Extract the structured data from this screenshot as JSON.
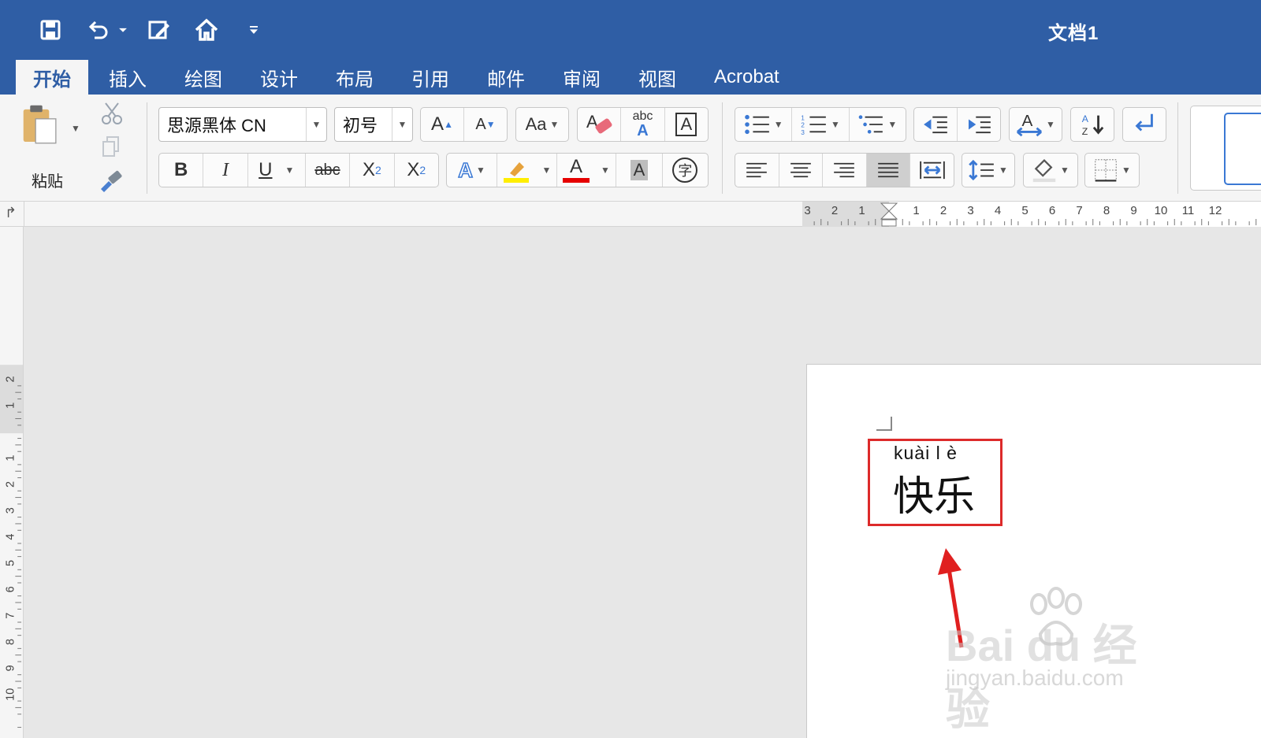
{
  "window": {
    "title": "文档1"
  },
  "quick_access": [
    {
      "name": "save-icon"
    },
    {
      "name": "undo-icon"
    },
    {
      "name": "edit-document-icon"
    },
    {
      "name": "home-icon"
    },
    {
      "name": "customize-toolbar-icon"
    }
  ],
  "tabs": [
    {
      "label": "开始",
      "active": true
    },
    {
      "label": "插入"
    },
    {
      "label": "绘图"
    },
    {
      "label": "设计"
    },
    {
      "label": "布局"
    },
    {
      "label": "引用"
    },
    {
      "label": "邮件"
    },
    {
      "label": "审阅"
    },
    {
      "label": "视图"
    },
    {
      "label": "Acrobat"
    }
  ],
  "clipboard": {
    "paste_label": "粘贴"
  },
  "font": {
    "name": "思源黑体 CN",
    "size": "初号"
  },
  "font_buttons": {
    "bold": "B",
    "italic": "I",
    "underline": "U",
    "strikethrough": "abc",
    "subscript": "X",
    "subscript_mark": "2",
    "superscript": "X",
    "superscript_mark": "2",
    "grow": "A",
    "shrink": "A",
    "change_case": "Aa",
    "phonetic_top": "abc",
    "phonetic_bottom": "A",
    "char_border": "A",
    "text_effects": "A",
    "font_color": "A",
    "char_shading": "A",
    "enclose": "字"
  },
  "colors": {
    "titlebar": "#2f5ea5",
    "highlight": "#ffee00",
    "font_color": "#e60000",
    "annotation": "#dd2a2a"
  },
  "ruler": {
    "h_left": [
      "3",
      "2",
      "1"
    ],
    "h_right": [
      "1",
      "2",
      "3",
      "4",
      "5",
      "6",
      "7",
      "8",
      "9",
      "10",
      "11",
      "12"
    ],
    "v_top": [
      "2",
      "1"
    ],
    "v_bottom": [
      "1",
      "2",
      "3",
      "4",
      "5",
      "6",
      "7",
      "8",
      "9",
      "10"
    ]
  },
  "document": {
    "pinyin": "kuài l è",
    "text": "快乐"
  },
  "watermark": {
    "brand": "Bai du 经验",
    "url": "jingyan.baidu.com"
  }
}
